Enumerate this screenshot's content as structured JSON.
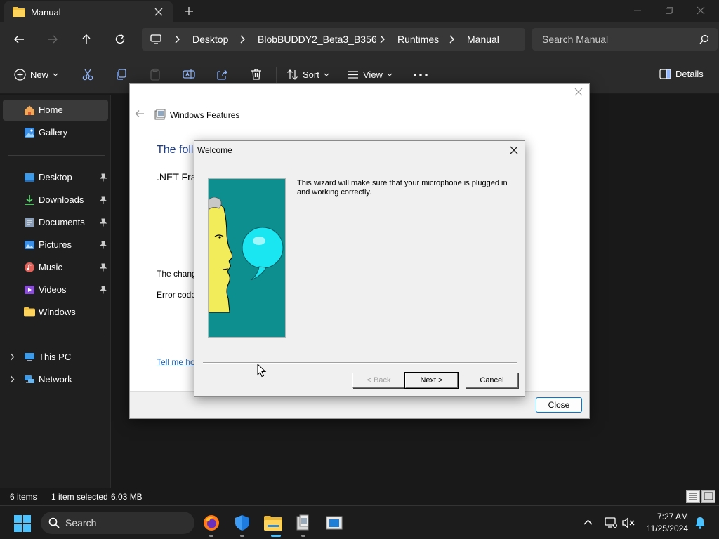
{
  "window": {
    "tab_title": "Manual",
    "search_placeholder": "Search Manual",
    "breadcrumbs": [
      "Desktop",
      "BlobBUDDY2_Beta3_B356",
      "Runtimes",
      "Manual"
    ]
  },
  "toolbar": {
    "new_label": "New",
    "sort_label": "Sort",
    "view_label": "View",
    "details_label": "Details"
  },
  "sidebar": {
    "items": [
      {
        "label": "Home",
        "icon": "home-icon"
      },
      {
        "label": "Gallery",
        "icon": "gallery-icon"
      },
      {
        "label": "Desktop",
        "icon": "desktop-icon"
      },
      {
        "label": "Downloads",
        "icon": "downloads-icon"
      },
      {
        "label": "Documents",
        "icon": "documents-icon"
      },
      {
        "label": "Pictures",
        "icon": "pictures-icon"
      },
      {
        "label": "Music",
        "icon": "music-icon"
      },
      {
        "label": "Videos",
        "icon": "videos-icon"
      },
      {
        "label": "Windows",
        "icon": "folder-icon"
      },
      {
        "label": "This PC",
        "icon": "this-pc-icon"
      },
      {
        "label": "Network",
        "icon": "network-icon"
      }
    ]
  },
  "status": {
    "items_count": "6 items",
    "selection": "1 item selected",
    "size": "6.03 MB"
  },
  "windows_features": {
    "title": "Windows Features",
    "heading": "The foll",
    "line1": ".NET Fra",
    "line2": "The chang",
    "line3": "Error code",
    "link": "Tell me ho",
    "close_button": "Close"
  },
  "wizard": {
    "title": "Welcome",
    "message": "This wizard will make sure that your microphone is plugged in and working correctly.",
    "back_button": "< Back",
    "next_button": "Next >",
    "cancel_button": "Cancel"
  },
  "taskbar": {
    "search_label": "Search",
    "time": "7:27 AM",
    "date": "11/25/2024"
  },
  "colors": {
    "accent": "#0078d4",
    "folder": "#f4c242",
    "wizard_art_bg": "#0c8f8e",
    "heading_blue": "#1e3e8a"
  }
}
